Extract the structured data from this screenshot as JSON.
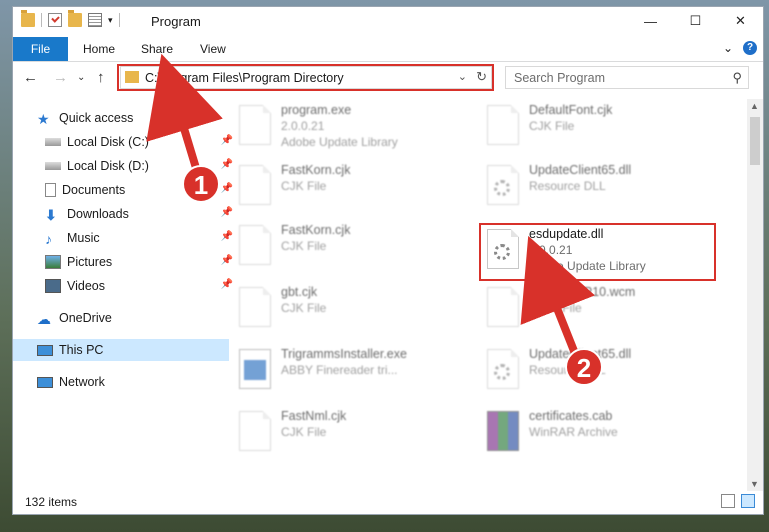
{
  "window": {
    "title": "Program",
    "controls": {
      "minimize": "—",
      "maximize": "☐",
      "close": "✕"
    }
  },
  "ribbon": {
    "tabs": [
      "File",
      "Home",
      "Share",
      "View"
    ],
    "expand_icon": "⌄",
    "help_icon": "?"
  },
  "nav": {
    "back": "←",
    "forward": "→",
    "recent": "⌄",
    "up": "↑",
    "address": "C:\\Program Files\\Program Directory",
    "dropdown": "⌄",
    "refresh": "↻",
    "search_placeholder": "Search Program",
    "search_icon": "⚲"
  },
  "sidebar": {
    "items": [
      {
        "label": "Quick access",
        "icon": "star-icon",
        "pinned": false
      },
      {
        "label": "Local Disk (C:)",
        "icon": "drive-icon",
        "pinned": true
      },
      {
        "label": "Local Disk (D:)",
        "icon": "drive-icon",
        "pinned": true
      },
      {
        "label": "Documents",
        "icon": "documents-icon",
        "pinned": true
      },
      {
        "label": "Downloads",
        "icon": "downloads-icon",
        "pinned": true
      },
      {
        "label": "Music",
        "icon": "music-icon",
        "pinned": true
      },
      {
        "label": "Pictures",
        "icon": "pictures-icon",
        "pinned": true
      },
      {
        "label": "Videos",
        "icon": "videos-icon",
        "pinned": true
      },
      {
        "label": "OneDrive",
        "icon": "cloud-icon",
        "pinned": false
      },
      {
        "label": "This PC",
        "icon": "pc-icon",
        "pinned": false,
        "selected": true
      },
      {
        "label": "Network",
        "icon": "network-icon",
        "pinned": false
      }
    ],
    "pin_glyph": "📌"
  },
  "files": [
    {
      "name": "program.exe",
      "line1": "2.0.0.21",
      "line2": "Adobe Update Library",
      "icon": "exe-icon",
      "blurred": true
    },
    {
      "name": "DefaultFont.cjk",
      "line1": "CJK File",
      "line2": "",
      "icon": "doc-icon",
      "blurred": true
    },
    {
      "name": "FastKorn.cjk",
      "line1": "CJK File",
      "line2": "",
      "icon": "doc-icon",
      "blurred": true
    },
    {
      "name": "UpdateClient65.dll",
      "line1": "Resource DLL",
      "line2": "",
      "icon": "dll-icon",
      "blurred": true
    },
    {
      "name": "FastKorn.cjk",
      "line1": "CJK File",
      "line2": "",
      "icon": "doc-icon",
      "blurred": true
    },
    {
      "name": "esdupdate.dll",
      "line1": "2.0.0.21",
      "line2": "Adobe Update Library",
      "icon": "dll-icon",
      "blurred": false
    },
    {
      "name": "gbt.cjk",
      "line1": "CJK File",
      "line2": "",
      "icon": "doc-icon",
      "blurred": true
    },
    {
      "name": "SmoothWP10.wcm",
      "line1": "WCM File",
      "line2": "",
      "icon": "doc-icon",
      "blurred": true
    },
    {
      "name": "TrigrammsInstaller.exe",
      "line1": "ABBY Finereader tri...",
      "line2": "",
      "icon": "installer-icon",
      "blurred": true
    },
    {
      "name": "UpdateClient65.dll",
      "line1": "Resource DLL",
      "line2": "",
      "icon": "dll-icon",
      "blurred": true
    },
    {
      "name": "FastNml.cjk",
      "line1": "CJK File",
      "line2": "",
      "icon": "doc-icon",
      "blurred": true
    },
    {
      "name": "certificates.cab",
      "line1": "WinRAR Archive",
      "line2": "",
      "icon": "winrar-icon",
      "blurred": true
    }
  ],
  "status": {
    "items": "132 items"
  },
  "annotations": {
    "callout1": "1",
    "callout2": "2"
  },
  "colors": {
    "accent": "#1979ca",
    "highlight": "#d8312a",
    "selected": "#cce8ff"
  }
}
